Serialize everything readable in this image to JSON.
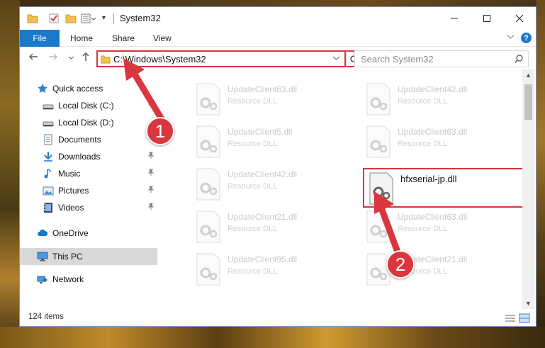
{
  "window": {
    "title": "System32"
  },
  "ribbon": {
    "file": "File",
    "home": "Home",
    "share": "Share",
    "view": "View",
    "help": "?"
  },
  "nav": {
    "address": "C:\\Windows\\System32",
    "search_placeholder": "Search System32"
  },
  "sidebar": {
    "items": [
      {
        "label": "Quick access",
        "icon": "star-icon"
      },
      {
        "label": "Local Disk (C:)",
        "icon": "drive-icon"
      },
      {
        "label": "Local Disk (D:)",
        "icon": "drive-icon"
      },
      {
        "label": "Documents",
        "icon": "documents-icon"
      },
      {
        "label": "Downloads",
        "icon": "download-arrow-icon"
      },
      {
        "label": "Music",
        "icon": "music-note-icon"
      },
      {
        "label": "Pictures",
        "icon": "pictures-icon"
      },
      {
        "label": "Videos",
        "icon": "videos-icon"
      },
      {
        "label": "OneDrive",
        "icon": "cloud-icon"
      },
      {
        "label": "This PC",
        "icon": "monitor-icon"
      },
      {
        "label": "Network",
        "icon": "network-icon"
      }
    ]
  },
  "files": [
    {
      "name": "UpdateClient63.dll",
      "type": "Resource DLL"
    },
    {
      "name": "UpdateClient42.dll",
      "type": "Resource DLL"
    },
    {
      "name": "UpdateClient5.dll",
      "type": "Resource DLL"
    },
    {
      "name": "UpdateClient63.dll",
      "type": "Resource DLL"
    },
    {
      "name": "UpdateClient42.dll",
      "type": "Resource DLL"
    },
    {
      "name": "hfxserial-jp.dll",
      "type": ""
    },
    {
      "name": "UpdateClient21.dll",
      "type": "Resource DLL"
    },
    {
      "name": "UpdateClient63.dll",
      "type": "Resource DLL"
    },
    {
      "name": "UpdateClient95.dll",
      "type": "Resource DLL"
    },
    {
      "name": "UpdateClient21.dll",
      "type": "Resource DLL"
    }
  ],
  "status": {
    "count": "124 items"
  },
  "annotations": {
    "step1": "1",
    "step2": "2",
    "color": "#d9363e"
  }
}
